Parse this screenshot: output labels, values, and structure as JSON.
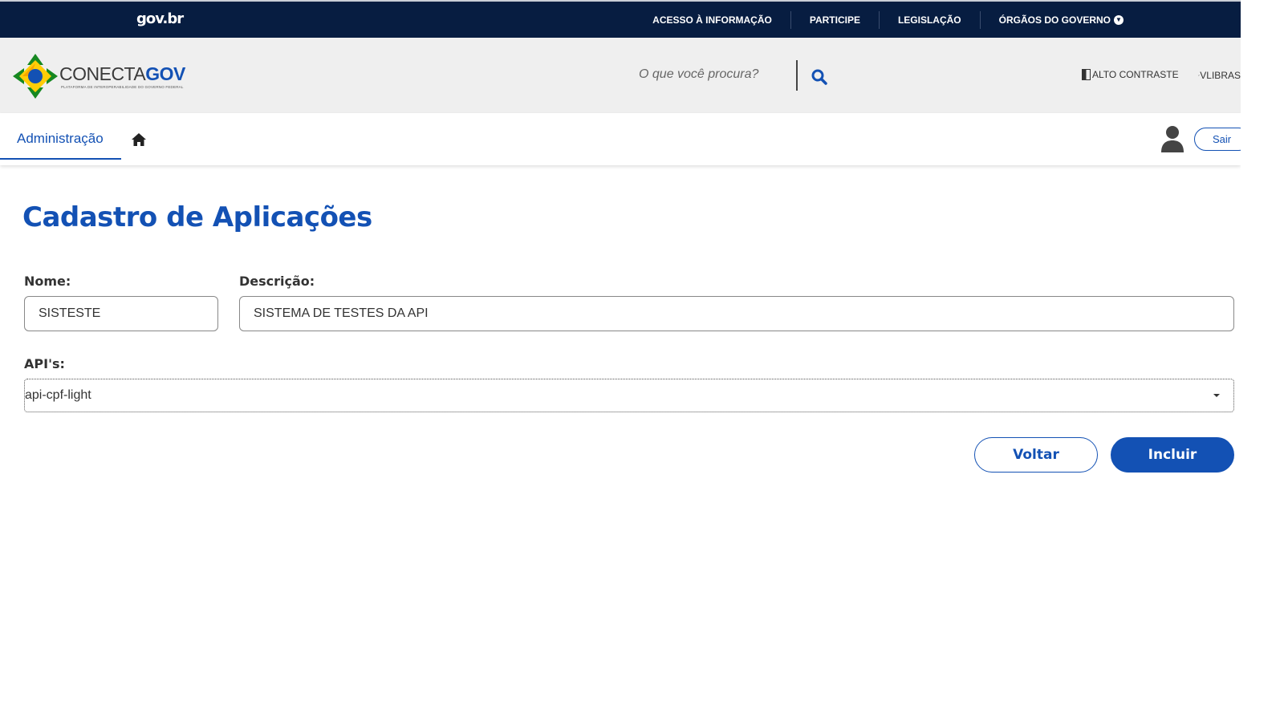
{
  "govbar": {
    "brand": "gov.br",
    "links": [
      "ACESSO À INFORMAÇÃO",
      "PARTICIPE",
      "LEGISLAÇÃO",
      "ÓRGÃOS DO GOVERNO"
    ]
  },
  "header": {
    "logo_name_part1": "CONECTA",
    "logo_name_part2": "GOV",
    "logo_subtitle": "PLATAFORMA DE INTEROPERABILIDADE DO GOVERNO FEDERAL",
    "search_placeholder": "O que você procura?",
    "contrast_label": "ALTO CONTRASTE",
    "vlibras_label": "VLIBRAS"
  },
  "nav": {
    "tab_label": "Administração",
    "logout_label": "Sair"
  },
  "main": {
    "title": "Cadastro de Aplicações",
    "nome_label": "Nome:",
    "nome_value": "SISTESTE",
    "descricao_label": "Descrição:",
    "descricao_value": "SISTEMA DE TESTES DA API",
    "apis_label": "API's:",
    "apis_selected": "api-cpf-light",
    "voltar_label": "Voltar",
    "incluir_label": "Incluir"
  },
  "colors": {
    "govbar_bg": "#071d41",
    "primary": "#1351b4",
    "header_bg": "#efefef",
    "logo_green": "#168821",
    "logo_yellow": "#ffcd07"
  }
}
